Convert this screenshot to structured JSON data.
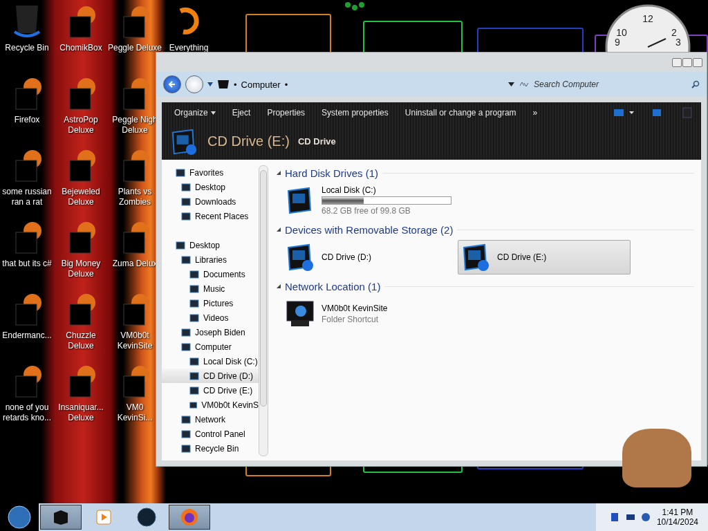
{
  "desktop": {
    "columns": [
      [
        {
          "lines": [
            "Recycle Bin"
          ],
          "kind": "trash"
        },
        {
          "lines": [
            "Firefox"
          ],
          "kind": "censored"
        },
        {
          "lines": [
            "some russian",
            "ran a rat"
          ],
          "kind": "censored"
        },
        {
          "lines": [
            "that but its c#"
          ],
          "kind": "censored"
        },
        {
          "lines": [
            "Endermanc..."
          ],
          "kind": "censored"
        },
        {
          "lines": [
            "none of you",
            "retards kno..."
          ],
          "kind": "censored"
        }
      ],
      [
        {
          "lines": [
            "ChomikBox"
          ],
          "kind": "censored"
        },
        {
          "lines": [
            "AstroPop",
            "Deluxe"
          ],
          "kind": "censored"
        },
        {
          "lines": [
            "Bejeweled",
            "Deluxe"
          ],
          "kind": "censored"
        },
        {
          "lines": [
            "Big Money",
            "Deluxe"
          ],
          "kind": "censored"
        },
        {
          "lines": [
            "Chuzzle",
            "Deluxe"
          ],
          "kind": "censored"
        },
        {
          "lines": [
            "Insaniquar...",
            "Deluxe"
          ],
          "kind": "censored"
        }
      ],
      [
        {
          "lines": [
            "Peggle Deluxe"
          ],
          "kind": "censored"
        },
        {
          "lines": [
            "Peggle Nigh",
            "Deluxe"
          ],
          "kind": "censored"
        },
        {
          "lines": [
            "Plants vs",
            "Zombies"
          ],
          "kind": "censored"
        },
        {
          "lines": [
            "Zuma Delux"
          ],
          "kind": "censored"
        },
        {
          "lines": [
            "VM0b0t",
            "KevinSite"
          ],
          "kind": "censored"
        },
        {
          "lines": [
            "VM0",
            "KevinSi..."
          ],
          "kind": "censored"
        }
      ],
      [
        {
          "lines": [
            "Everything"
          ],
          "kind": "ring"
        }
      ]
    ]
  },
  "clock": {
    "numerals": [
      "10",
      "12",
      "2",
      "9",
      "3"
    ]
  },
  "window": {
    "address": {
      "location": "Computer",
      "separator": "•",
      "search_placeholder": "Search Computer"
    },
    "toolbar": {
      "items": [
        {
          "label": "Organize",
          "dropdown": true
        },
        {
          "label": "Eject",
          "dropdown": false
        },
        {
          "label": "Properties",
          "dropdown": false
        },
        {
          "label": "System properties",
          "dropdown": false
        },
        {
          "label": "Uninstall or change a program",
          "dropdown": false
        },
        {
          "label": "»",
          "dropdown": false
        }
      ]
    },
    "header": {
      "title": "CD Drive (E:)",
      "subtitle": "CD Drive"
    },
    "nav": [
      {
        "label": "Favorites",
        "selected": false,
        "children": [
          {
            "label": "Desktop",
            "selected": false
          },
          {
            "label": "Downloads",
            "selected": false
          },
          {
            "label": "Recent Places",
            "selected": false
          }
        ]
      },
      {
        "label": "Desktop",
        "selected": false,
        "children": [
          {
            "label": "Libraries",
            "selected": false,
            "children": [
              {
                "label": "Documents",
                "selected": false
              },
              {
                "label": "Music",
                "selected": false
              },
              {
                "label": "Pictures",
                "selected": false
              },
              {
                "label": "Videos",
                "selected": false
              }
            ]
          },
          {
            "label": "Joseph Biden",
            "selected": false
          },
          {
            "label": "Computer",
            "selected": false,
            "children": [
              {
                "label": "Local Disk (C:)",
                "selected": false
              },
              {
                "label": "CD Drive (D:)",
                "selected": true
              },
              {
                "label": "CD Drive (E:)",
                "selected": false
              },
              {
                "label": "VM0b0t KevinS",
                "selected": false
              }
            ]
          },
          {
            "label": "Network",
            "selected": false
          },
          {
            "label": "Control Panel",
            "selected": false
          },
          {
            "label": "Recycle Bin",
            "selected": false
          }
        ]
      }
    ],
    "groups": [
      {
        "title": "Hard Disk Drives (1)",
        "items": [
          {
            "kind": "disk",
            "name": "Local Disk (C:)",
            "level": 0.32,
            "detail": "68.2 GB free of 99.8 GB",
            "selected": false
          }
        ]
      },
      {
        "title": "Devices with Removable Storage (2)",
        "items": [
          {
            "kind": "cd",
            "name": "CD Drive (D:)",
            "selected": false
          },
          {
            "kind": "cd",
            "name": "CD Drive (E:)",
            "selected": true
          }
        ]
      },
      {
        "title": "Network Location (1)",
        "items": [
          {
            "kind": "shortcut",
            "name": "VM0b0t KevinSite",
            "detail": "Folder Shortcut",
            "selected": false
          }
        ]
      }
    ]
  },
  "taskbar": {
    "buttons": [
      {
        "kind": "explorer",
        "active": true
      },
      {
        "kind": "player",
        "active": false
      },
      {
        "kind": "globe",
        "active": false
      },
      {
        "kind": "firefox",
        "active": true
      }
    ],
    "time": "1:41 PM",
    "date": "10/14/2024"
  }
}
